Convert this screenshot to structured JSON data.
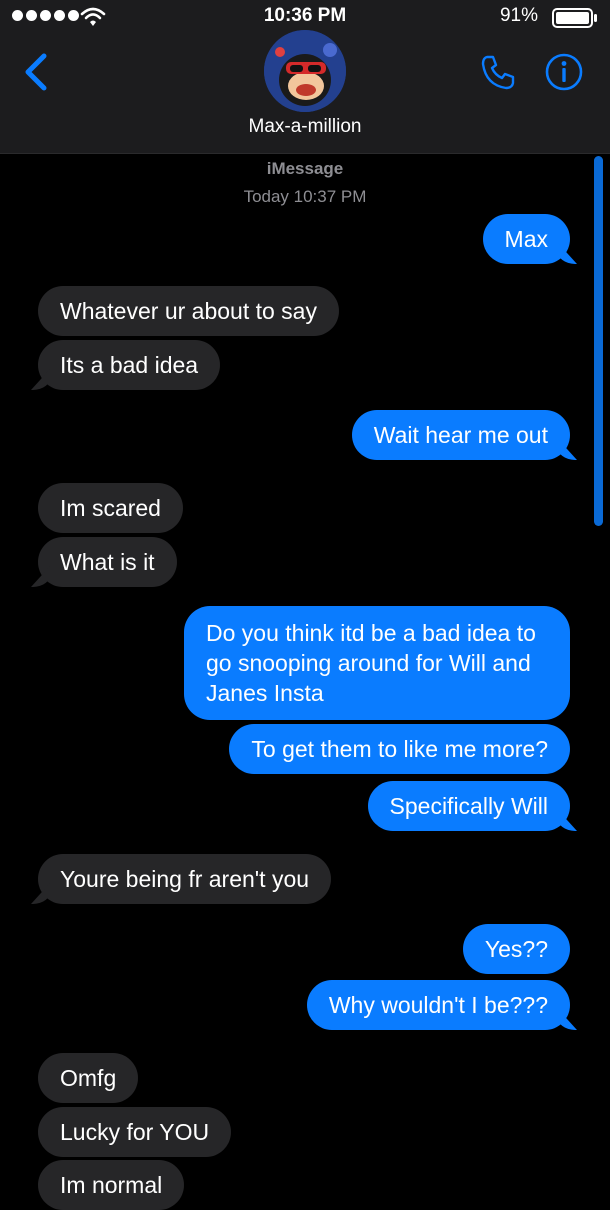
{
  "status_bar": {
    "time": "10:36 PM",
    "battery": "91%",
    "icons": [
      "signal-dots-icon",
      "wifi-icon",
      "battery-icon"
    ]
  },
  "header": {
    "contact_name": "Max-a-million",
    "icons": [
      "back-chevron-icon",
      "phone-icon",
      "info-icon"
    ],
    "accent_color": "#0a7cff"
  },
  "conversation": {
    "service": "iMessage",
    "timestamp": "Today 10:37 PM",
    "messages": [
      {
        "from": "me",
        "text": "Max"
      },
      {
        "from": "them",
        "text": "Whatever ur about to say"
      },
      {
        "from": "them",
        "text": "Its a bad idea"
      },
      {
        "from": "me",
        "text": "Wait hear me out"
      },
      {
        "from": "them",
        "text": "Im scared"
      },
      {
        "from": "them",
        "text": "What is it"
      },
      {
        "from": "me",
        "text": "Do you think itd be a bad idea to go snooping around for Will and Janes Insta"
      },
      {
        "from": "me",
        "text": "To get them to like me more?"
      },
      {
        "from": "me",
        "text": "Specifically Will"
      },
      {
        "from": "them",
        "text": "Youre being fr aren't you"
      },
      {
        "from": "me",
        "text": "Yes??"
      },
      {
        "from": "me",
        "text": "Why wouldn't I be???"
      },
      {
        "from": "them",
        "text": "Omfg"
      },
      {
        "from": "them",
        "text": "Lucky for YOU"
      },
      {
        "from": "them",
        "text": "Im normal"
      }
    ]
  },
  "colors": {
    "sent_bubble": "#0a7cff",
    "received_bubble": "#262628",
    "background": "#000000",
    "header_bg": "#1c1c1e"
  }
}
